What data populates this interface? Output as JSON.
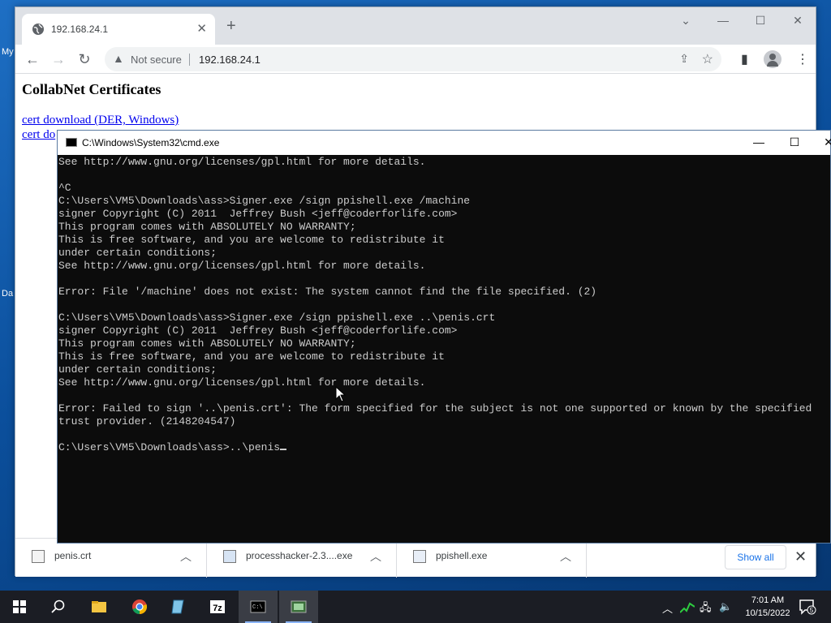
{
  "desktop": {
    "fragments": [
      "My",
      "Da"
    ]
  },
  "browser": {
    "tab_title": "192.168.24.1",
    "new_tab": "+",
    "security_label": "Not secure",
    "url": "192.168.24.1",
    "page": {
      "heading": "CollabNet Certificates",
      "links": [
        "cert download (DER, Windows)",
        "cert do"
      ]
    },
    "downloads": {
      "items": [
        {
          "name": "penis.crt"
        },
        {
          "name": "processhacker-2.3....exe"
        },
        {
          "name": "ppishell.exe"
        }
      ],
      "show_all": "Show all"
    }
  },
  "cmd": {
    "title": "C:\\Windows\\System32\\cmd.exe",
    "lines": [
      "See http://www.gnu.org/licenses/gpl.html for more details.",
      "",
      "^C",
      "C:\\Users\\VM5\\Downloads\\ass>Signer.exe /sign ppishell.exe /machine",
      "signer Copyright (C) 2011  Jeffrey Bush <jeff@coderforlife.com>",
      "This program comes with ABSOLUTELY NO WARRANTY;",
      "This is free software, and you are welcome to redistribute it",
      "under certain conditions;",
      "See http://www.gnu.org/licenses/gpl.html for more details.",
      "",
      "Error: File '/machine' does not exist: The system cannot find the file specified. (2)",
      "",
      "C:\\Users\\VM5\\Downloads\\ass>Signer.exe /sign ppishell.exe ..\\penis.crt",
      "signer Copyright (C) 2011  Jeffrey Bush <jeff@coderforlife.com>",
      "This program comes with ABSOLUTELY NO WARRANTY;",
      "This is free software, and you are welcome to redistribute it",
      "under certain conditions;",
      "See http://www.gnu.org/licenses/gpl.html for more details.",
      "",
      "Error: Failed to sign '..\\penis.crt': The form specified for the subject is not one supported or known by the specified",
      "trust provider. (2148204547)",
      "",
      "C:\\Users\\VM5\\Downloads\\ass>..\\penis"
    ]
  },
  "taskbar": {
    "apps": [
      "start-button",
      "search-button",
      "file-explorer",
      "chrome",
      "notepad",
      "7zip",
      "cmd",
      "signer-app"
    ],
    "clock_time": "7:01 AM",
    "clock_date": "10/15/2022",
    "notification_count": "5"
  }
}
